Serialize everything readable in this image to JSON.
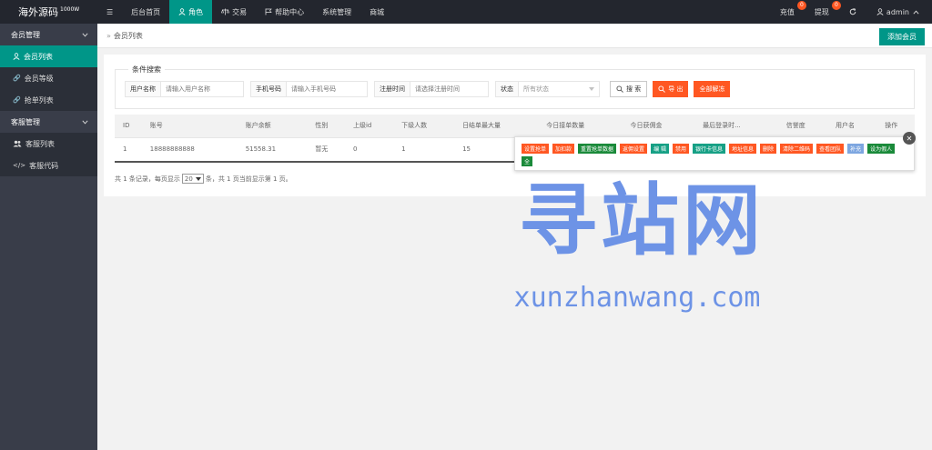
{
  "header": {
    "logo": "海外源码",
    "logo_sup": "1000W",
    "menu_icon": "☰",
    "nav": [
      {
        "label": "后台首页",
        "icon": ""
      },
      {
        "label": "角色",
        "icon": "person-icon"
      },
      {
        "label": "交易",
        "icon": "scale-icon"
      },
      {
        "label": "帮助中心",
        "icon": "flag-icon"
      },
      {
        "label": "系统管理",
        "icon": ""
      },
      {
        "label": "商城",
        "icon": ""
      }
    ],
    "recharge": {
      "label": "充值",
      "count": "0"
    },
    "withdraw": {
      "label": "提现",
      "count": "0"
    },
    "user": "admin"
  },
  "sidebar": {
    "groups": [
      {
        "label": "会员管理",
        "items": [
          {
            "label": "会员列表",
            "icon": "person-icon",
            "active": true
          },
          {
            "label": "会员等级",
            "icon": "link-icon"
          },
          {
            "label": "抢单列表",
            "icon": "link-icon"
          }
        ]
      },
      {
        "label": "客服管理",
        "items": [
          {
            "label": "客服列表",
            "icon": "users-icon"
          },
          {
            "label": "客服代码",
            "icon": "code-icon"
          }
        ]
      }
    ]
  },
  "breadcrumb": "会员列表",
  "add_member": "添加会员",
  "search": {
    "legend": "条件搜索",
    "username_label": "用户名称",
    "username_placeholder": "请输入用户名称",
    "phone_label": "手机号码",
    "phone_placeholder": "请输入手机号码",
    "regtime_label": "注册时间",
    "regtime_placeholder": "请选择注册时间",
    "status_label": "状态",
    "status_value": "所有状态",
    "search_btn": "搜 索",
    "export_btn": "导 出",
    "unfreeze_btn": "全部解冻"
  },
  "table": {
    "columns": [
      "ID",
      "账号",
      "账户余额",
      "性别",
      "上级id",
      "下级人数",
      "日结单最大量",
      "今日接单数量",
      "今日获佣金",
      "最后登录时...",
      "信誉度",
      "用户名",
      "操作"
    ],
    "rows": [
      [
        "1",
        "18888888888",
        "51558.31",
        "暂无",
        "0",
        "1",
        "15",
        "",
        "",
        "",
        "",
        "",
        ""
      ]
    ]
  },
  "pager": {
    "prefix": "共 1 条记录，每页显示",
    "page_size": "20",
    "suffix": "条，共 1 页当前显示第 1 页。"
  },
  "actions": [
    {
      "label": "设置抢单",
      "color": "#ff5722"
    },
    {
      "label": "加扣款",
      "color": "#ff5722"
    },
    {
      "label": "重置抢单数据",
      "color": "#1a8a3a"
    },
    {
      "label": "返佣设置",
      "color": "#ff5722"
    },
    {
      "label": "编 辑",
      "color": "#16a085"
    },
    {
      "label": "禁用",
      "color": "#ff5722"
    },
    {
      "label": "银行卡信息",
      "color": "#16a085"
    },
    {
      "label": "地址信息",
      "color": "#ff5722"
    },
    {
      "label": "删除",
      "color": "#ff5722"
    },
    {
      "label": "清除二维码",
      "color": "#ff5722"
    },
    {
      "label": "查看团队",
      "color": "#ff5722"
    },
    {
      "label": "补充",
      "color": "#7da6e0"
    },
    {
      "label": "设为假人",
      "color": "#1a8a3a"
    },
    {
      "label": "全",
      "color": "#1a8a3a"
    }
  ],
  "watermark": {
    "cn": "寻站网",
    "en": "xunzhanwang.com"
  }
}
